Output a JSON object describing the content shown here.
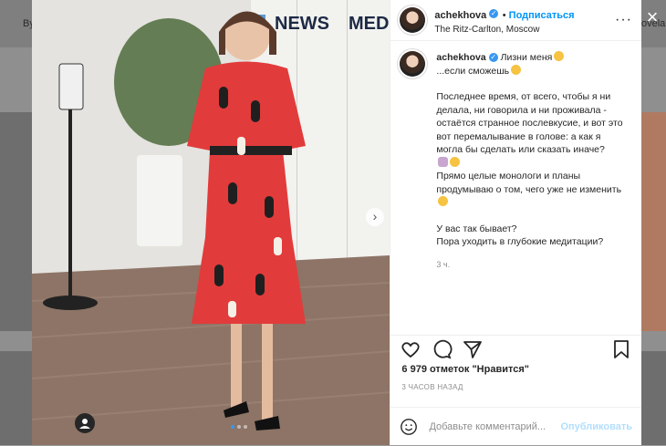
{
  "background": {
    "left_text": "By",
    "right_text": "ovela."
  },
  "photo": {
    "wall_sign_1": "NEWS",
    "wall_sign_2": "MED",
    "carousel_count": 3,
    "carousel_active": 1
  },
  "post": {
    "username": "achekhova",
    "follow_label": "Подписаться",
    "location": "The Ritz-Carlton, Moscow",
    "caption_line1": "Лизни меня",
    "caption_line2": "...если сможешь",
    "caption_para1": "Последнее время, от всего, чтобы я ни делала, ни говорила и ни проживала - остаётся странное послевкусие, и вот это вот перемалывание в голове: а как я могла бы сделать или сказать иначе?",
    "caption_para2": "Прямо целые монологи и планы продумываю о том, чего уже не изменить",
    "caption_q1": "У вас так бывает?",
    "caption_q2": "Пора уходить в глубокие медитации?",
    "caption_time": "3 ч.",
    "likes": "6 979 отметок \"Нравится\"",
    "posted": "3 ЧАСОВ НАЗАД",
    "comment_placeholder": "Добавьте комментарий...",
    "publish_label": "Опубликовать"
  },
  "icons": [
    "like-icon",
    "comment-icon",
    "share-icon",
    "save-icon",
    "emoji-icon",
    "more-icon",
    "verified-icon",
    "close-icon"
  ]
}
